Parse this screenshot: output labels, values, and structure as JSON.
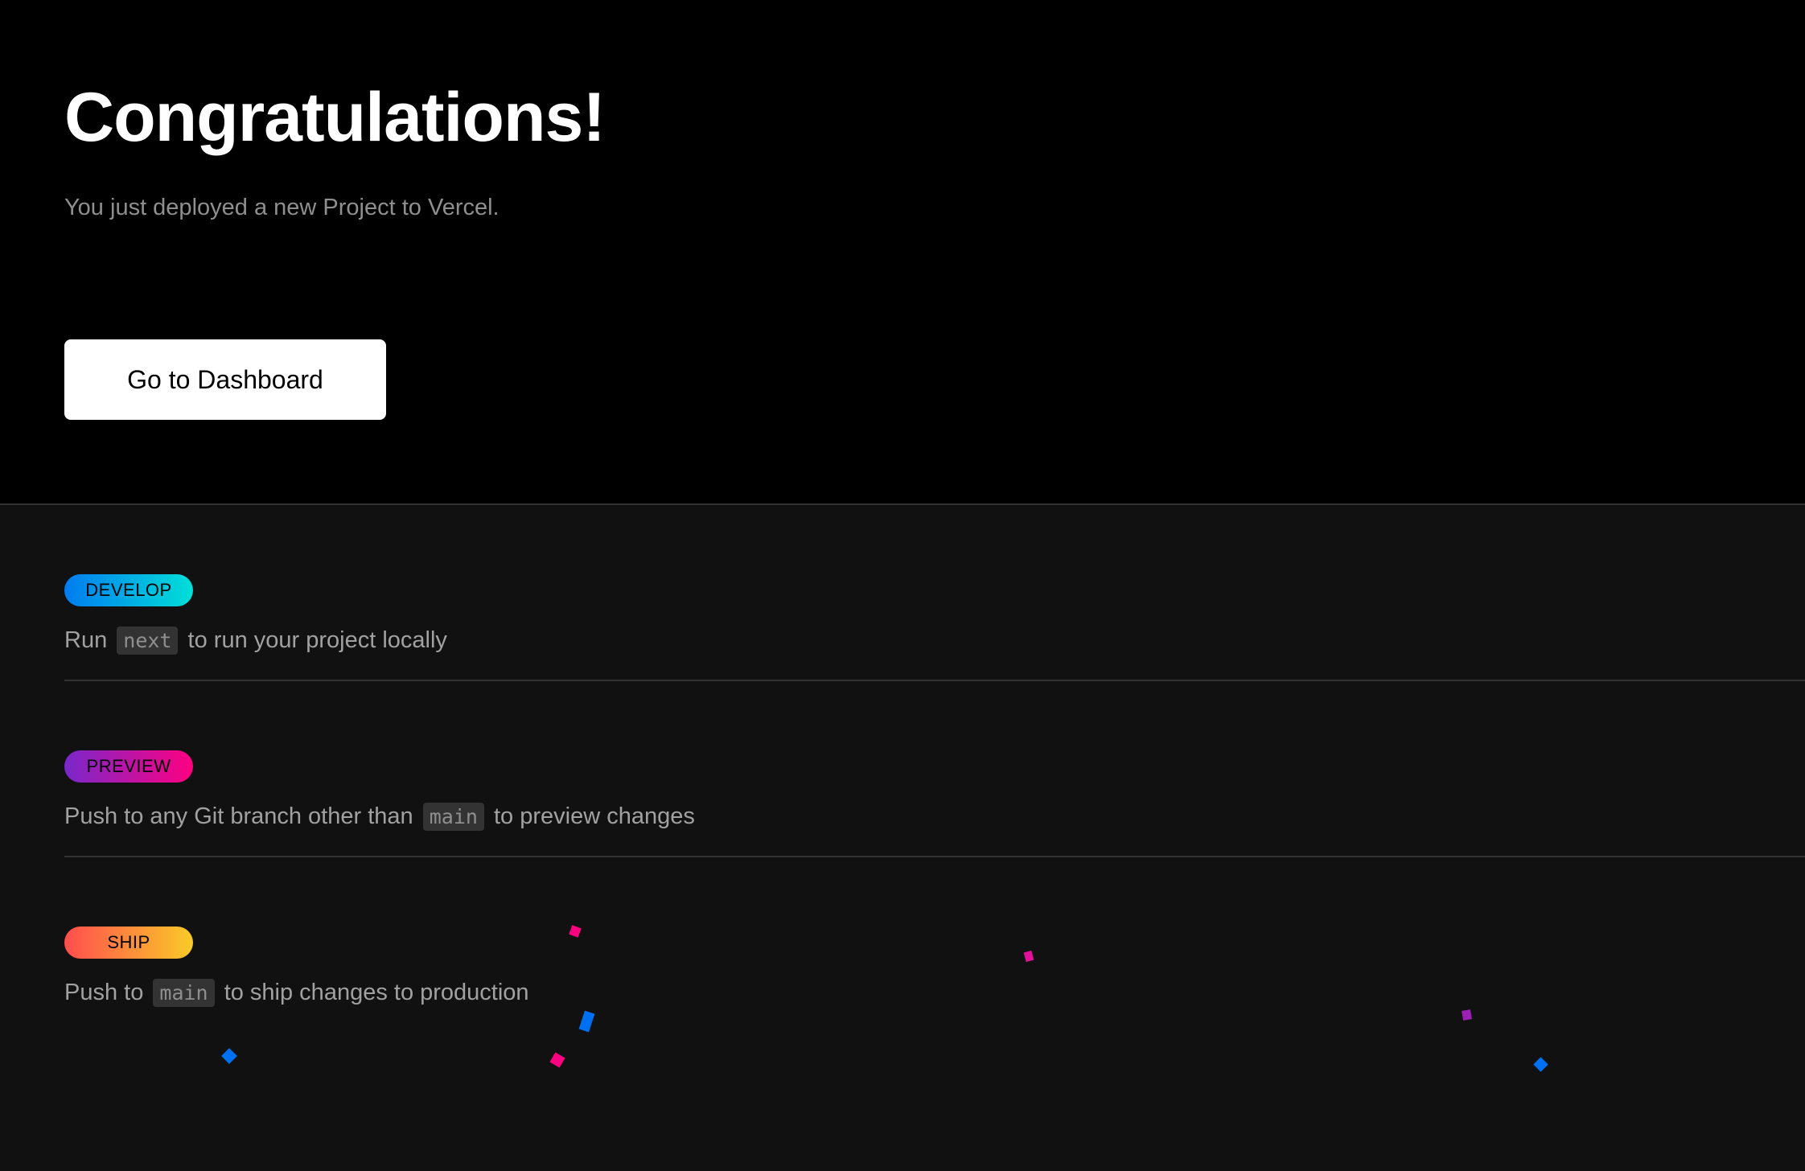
{
  "hero": {
    "title": "Congratulations!",
    "subtitle": "You just deployed a new Project to Vercel.",
    "button_label": "Go to Dashboard"
  },
  "steps": [
    {
      "badge": "DEVELOP",
      "text_before": "Run",
      "code": "next",
      "text_after": "to run your project locally",
      "gradient": [
        "#007cf0",
        "#00dfd8"
      ]
    },
    {
      "badge": "PREVIEW",
      "text_before": "Push to any Git branch other than",
      "code": "main",
      "text_after": "to preview changes",
      "gradient": [
        "#7928ca",
        "#ff0080"
      ]
    },
    {
      "badge": "SHIP",
      "text_before": "Push to",
      "code": "main",
      "text_after": "to ship changes to production",
      "gradient": [
        "#ff4d4d",
        "#f9cb28"
      ]
    }
  ],
  "colors": {
    "hero_background": "#000000",
    "section_background": "#111111",
    "divider": "#333333",
    "confetti_pink": "#ff0080",
    "confetti_blue": "#0070f3",
    "confetti_purple": "#9d1fb5"
  }
}
